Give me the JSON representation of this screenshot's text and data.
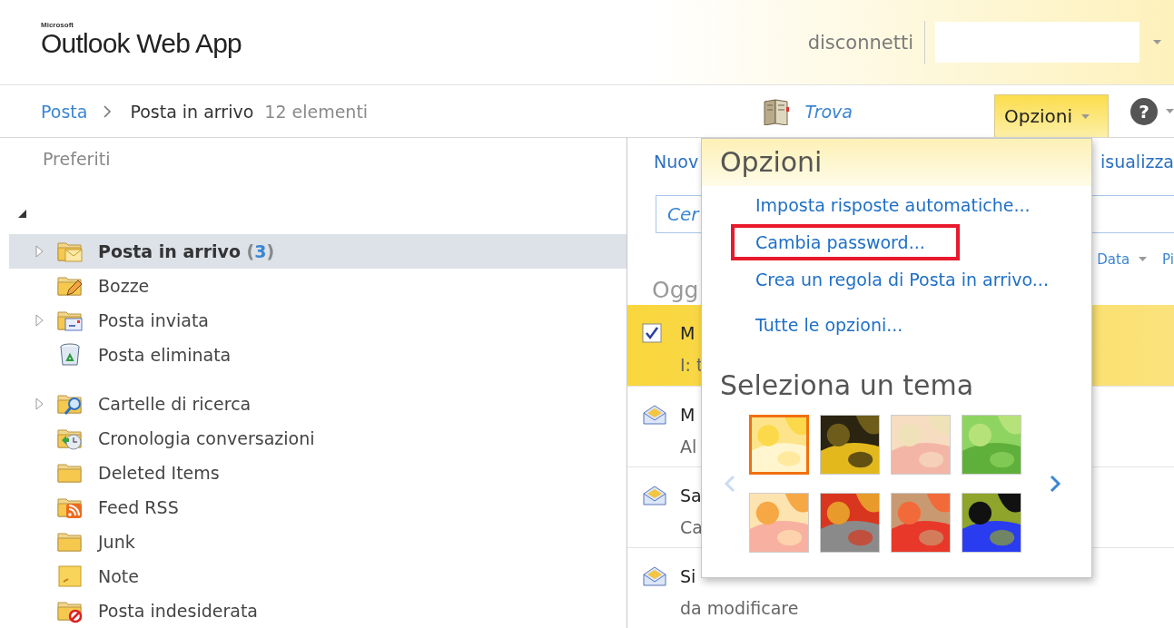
{
  "header": {
    "brand_small": "Microsoft",
    "brand": "Outlook Web App",
    "signout": "disconnetti"
  },
  "nav": {
    "breadcrumb_root": "Posta",
    "folder": "Posta in arrivo",
    "item_count": "12 elementi",
    "find": "Trova",
    "options_tab": {
      "label": "Opzioni",
      "selected": true
    },
    "help": "?"
  },
  "sidebar": {
    "favorites": "Preferiti",
    "mailbox": {
      "expanded": true
    },
    "sections": [
      {
        "folders": [
          {
            "kind": "inbox",
            "name": "Posta in arrivo",
            "count": "(3)",
            "expander": true,
            "unread": true,
            "selected": true
          },
          {
            "kind": "drafts",
            "name": "Bozze",
            "expander": false,
            "unread": false,
            "selected": false
          },
          {
            "kind": "sent",
            "name": "Posta inviata",
            "expander": true,
            "unread": false,
            "selected": false
          },
          {
            "kind": "trash",
            "name": "Posta eliminata",
            "expander": false,
            "unread": false,
            "selected": false
          }
        ]
      },
      {
        "folders": [
          {
            "kind": "search",
            "name": "Cartelle di ricerca",
            "expander": true,
            "unread": false,
            "selected": false
          },
          {
            "kind": "history",
            "name": "Cronologia conversazioni",
            "expander": false,
            "unread": false,
            "selected": false
          },
          {
            "kind": "folder",
            "name": "Deleted Items",
            "expander": false,
            "unread": false,
            "selected": false
          },
          {
            "kind": "rss",
            "name": "Feed RSS",
            "expander": false,
            "unread": false,
            "selected": false
          },
          {
            "kind": "folder",
            "name": "Junk",
            "expander": false,
            "unread": false,
            "selected": false
          },
          {
            "kind": "note",
            "name": "Note",
            "expander": false,
            "unread": false,
            "selected": false
          },
          {
            "kind": "junk",
            "name": "Posta indesiderata",
            "expander": false,
            "unread": false,
            "selected": false
          }
        ]
      }
    ]
  },
  "message_pane": {
    "new_button": "Nuov",
    "view_button": "isualizza",
    "search": {
      "placeholder": "Cer"
    },
    "sort": "Data",
    "sort_2": "Pi",
    "group_header": "Ogg",
    "messages": [
      {
        "selected": true,
        "line1": "M",
        "line2": "I: t"
      },
      {
        "selected": false,
        "line1": "M",
        "line2": "Al"
      },
      {
        "selected": false,
        "line1": "Sa",
        "line2": "Ca"
      },
      {
        "selected": false,
        "line1": "Si",
        "line2": "da modificare"
      }
    ]
  },
  "options_menu": {
    "title": "Opzioni",
    "item_groups": [
      {
        "items": [
          {
            "label": "Imposta risposte automatiche...",
            "highlighted": false
          },
          {
            "label": "Cambia password...",
            "highlighted": true
          },
          {
            "label": "Crea un regola di Posta in arrivo...",
            "highlighted": false
          }
        ]
      },
      {
        "items": [
          {
            "label": "Tutte le opzioni...",
            "highlighted": false
          }
        ]
      }
    ],
    "theme_title": "Seleziona un tema",
    "themes": [
      {
        "kind": "picture",
        "selected": true
      },
      {
        "kind": "picture",
        "selected": false
      },
      {
        "kind": "picture",
        "selected": false
      },
      {
        "kind": "picture",
        "selected": false
      },
      {
        "kind": "picture",
        "selected": false
      },
      {
        "kind": "picture",
        "selected": false
      },
      {
        "kind": "picture",
        "selected": false
      },
      {
        "kind": "picture",
        "selected": false
      }
    ],
    "previous": {
      "disabled": true
    },
    "next": {
      "disabled": false
    }
  }
}
